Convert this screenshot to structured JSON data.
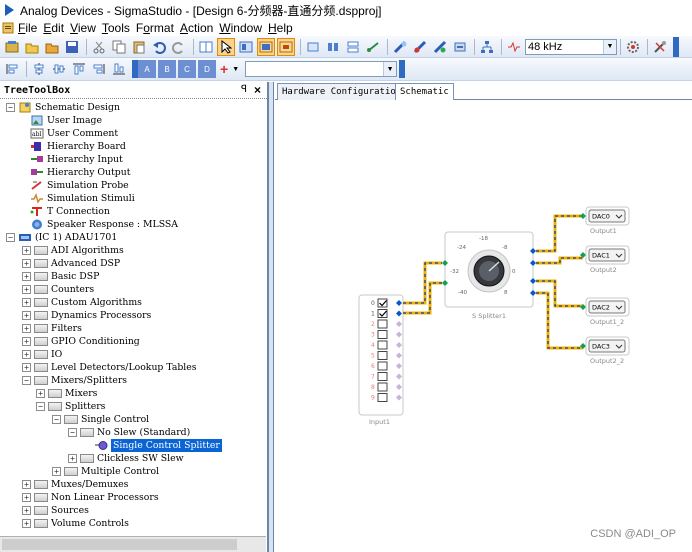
{
  "window": {
    "title": "Analog Devices - SigmaStudio - [Design 6-分频器-直通分频.dspproj]"
  },
  "menu": [
    "File",
    "Edit",
    "View",
    "Tools",
    "Format",
    "Action",
    "Window",
    "Help"
  ],
  "menu_underline": [
    "F",
    "E",
    "V",
    "T",
    "o",
    "A",
    "W",
    "H"
  ],
  "toolbar": {
    "sample_rate": "48 kHz",
    "plus_label": "+",
    "small_labels": [
      "A",
      "B",
      "C",
      "D"
    ]
  },
  "toolbox": {
    "header": "TreeToolBox",
    "pin": "ꟼ",
    "close": "×"
  },
  "tree": {
    "schematic_design": "Schematic Design",
    "schematic_items": [
      "User Image",
      "User Comment",
      "Hierarchy Board",
      "Hierarchy Input",
      "Hierarchy Output",
      "Simulation Probe",
      "Simulation Stimuli",
      "T Connection",
      "Speaker Response : MLSSA"
    ],
    "ic": "(IC 1) ADAU1701",
    "categories": [
      "ADI Algorithms",
      "Advanced DSP",
      "Basic DSP",
      "Counters",
      "Custom Algorithms",
      "Dynamics Processors",
      "Filters",
      "GPIO Conditioning",
      "IO",
      "Level Detectors/Lookup Tables",
      "Mixers/Splitters"
    ],
    "mixers": "Mixers",
    "splitters": "Splitters",
    "single_control": "Single Control",
    "no_slew": "No Slew (Standard)",
    "selected": "Single Control Splitter",
    "clickless": "Clickless SW Slew",
    "multiple_control": "Multiple Control",
    "after": [
      "Muxes/Demuxes",
      "Non Linear Processors",
      "Sources",
      "Volume Controls"
    ]
  },
  "tabs": [
    "Hardware Configuration",
    "Schematic"
  ],
  "schematic": {
    "input_block": {
      "label": "Input1",
      "channels": [
        "0",
        "1",
        "2",
        "3",
        "4",
        "5",
        "6",
        "7",
        "8",
        "9"
      ],
      "checked": [
        true,
        true,
        false,
        false,
        false,
        false,
        false,
        false,
        false,
        false
      ]
    },
    "splitter_block": {
      "label": "S Splitter1",
      "knob_ticks": [
        "-24",
        "-18",
        "-8",
        "-32",
        "0",
        "-40",
        "8"
      ]
    },
    "outputs": [
      {
        "value": "DAC0",
        "label": "Output1"
      },
      {
        "value": "DAC1",
        "label": "Output2"
      },
      {
        "value": "DAC2",
        "label": "Output1_2"
      },
      {
        "value": "DAC3",
        "label": "Output2_2"
      }
    ]
  },
  "watermark": "CSDN @ADI_OP",
  "colors": {
    "wire": "#f0b000",
    "wire_dash": "#1c3f8c",
    "pin_blue": "#0b56c8",
    "pin_green": "#12a050",
    "selection": "#0a64d4"
  }
}
